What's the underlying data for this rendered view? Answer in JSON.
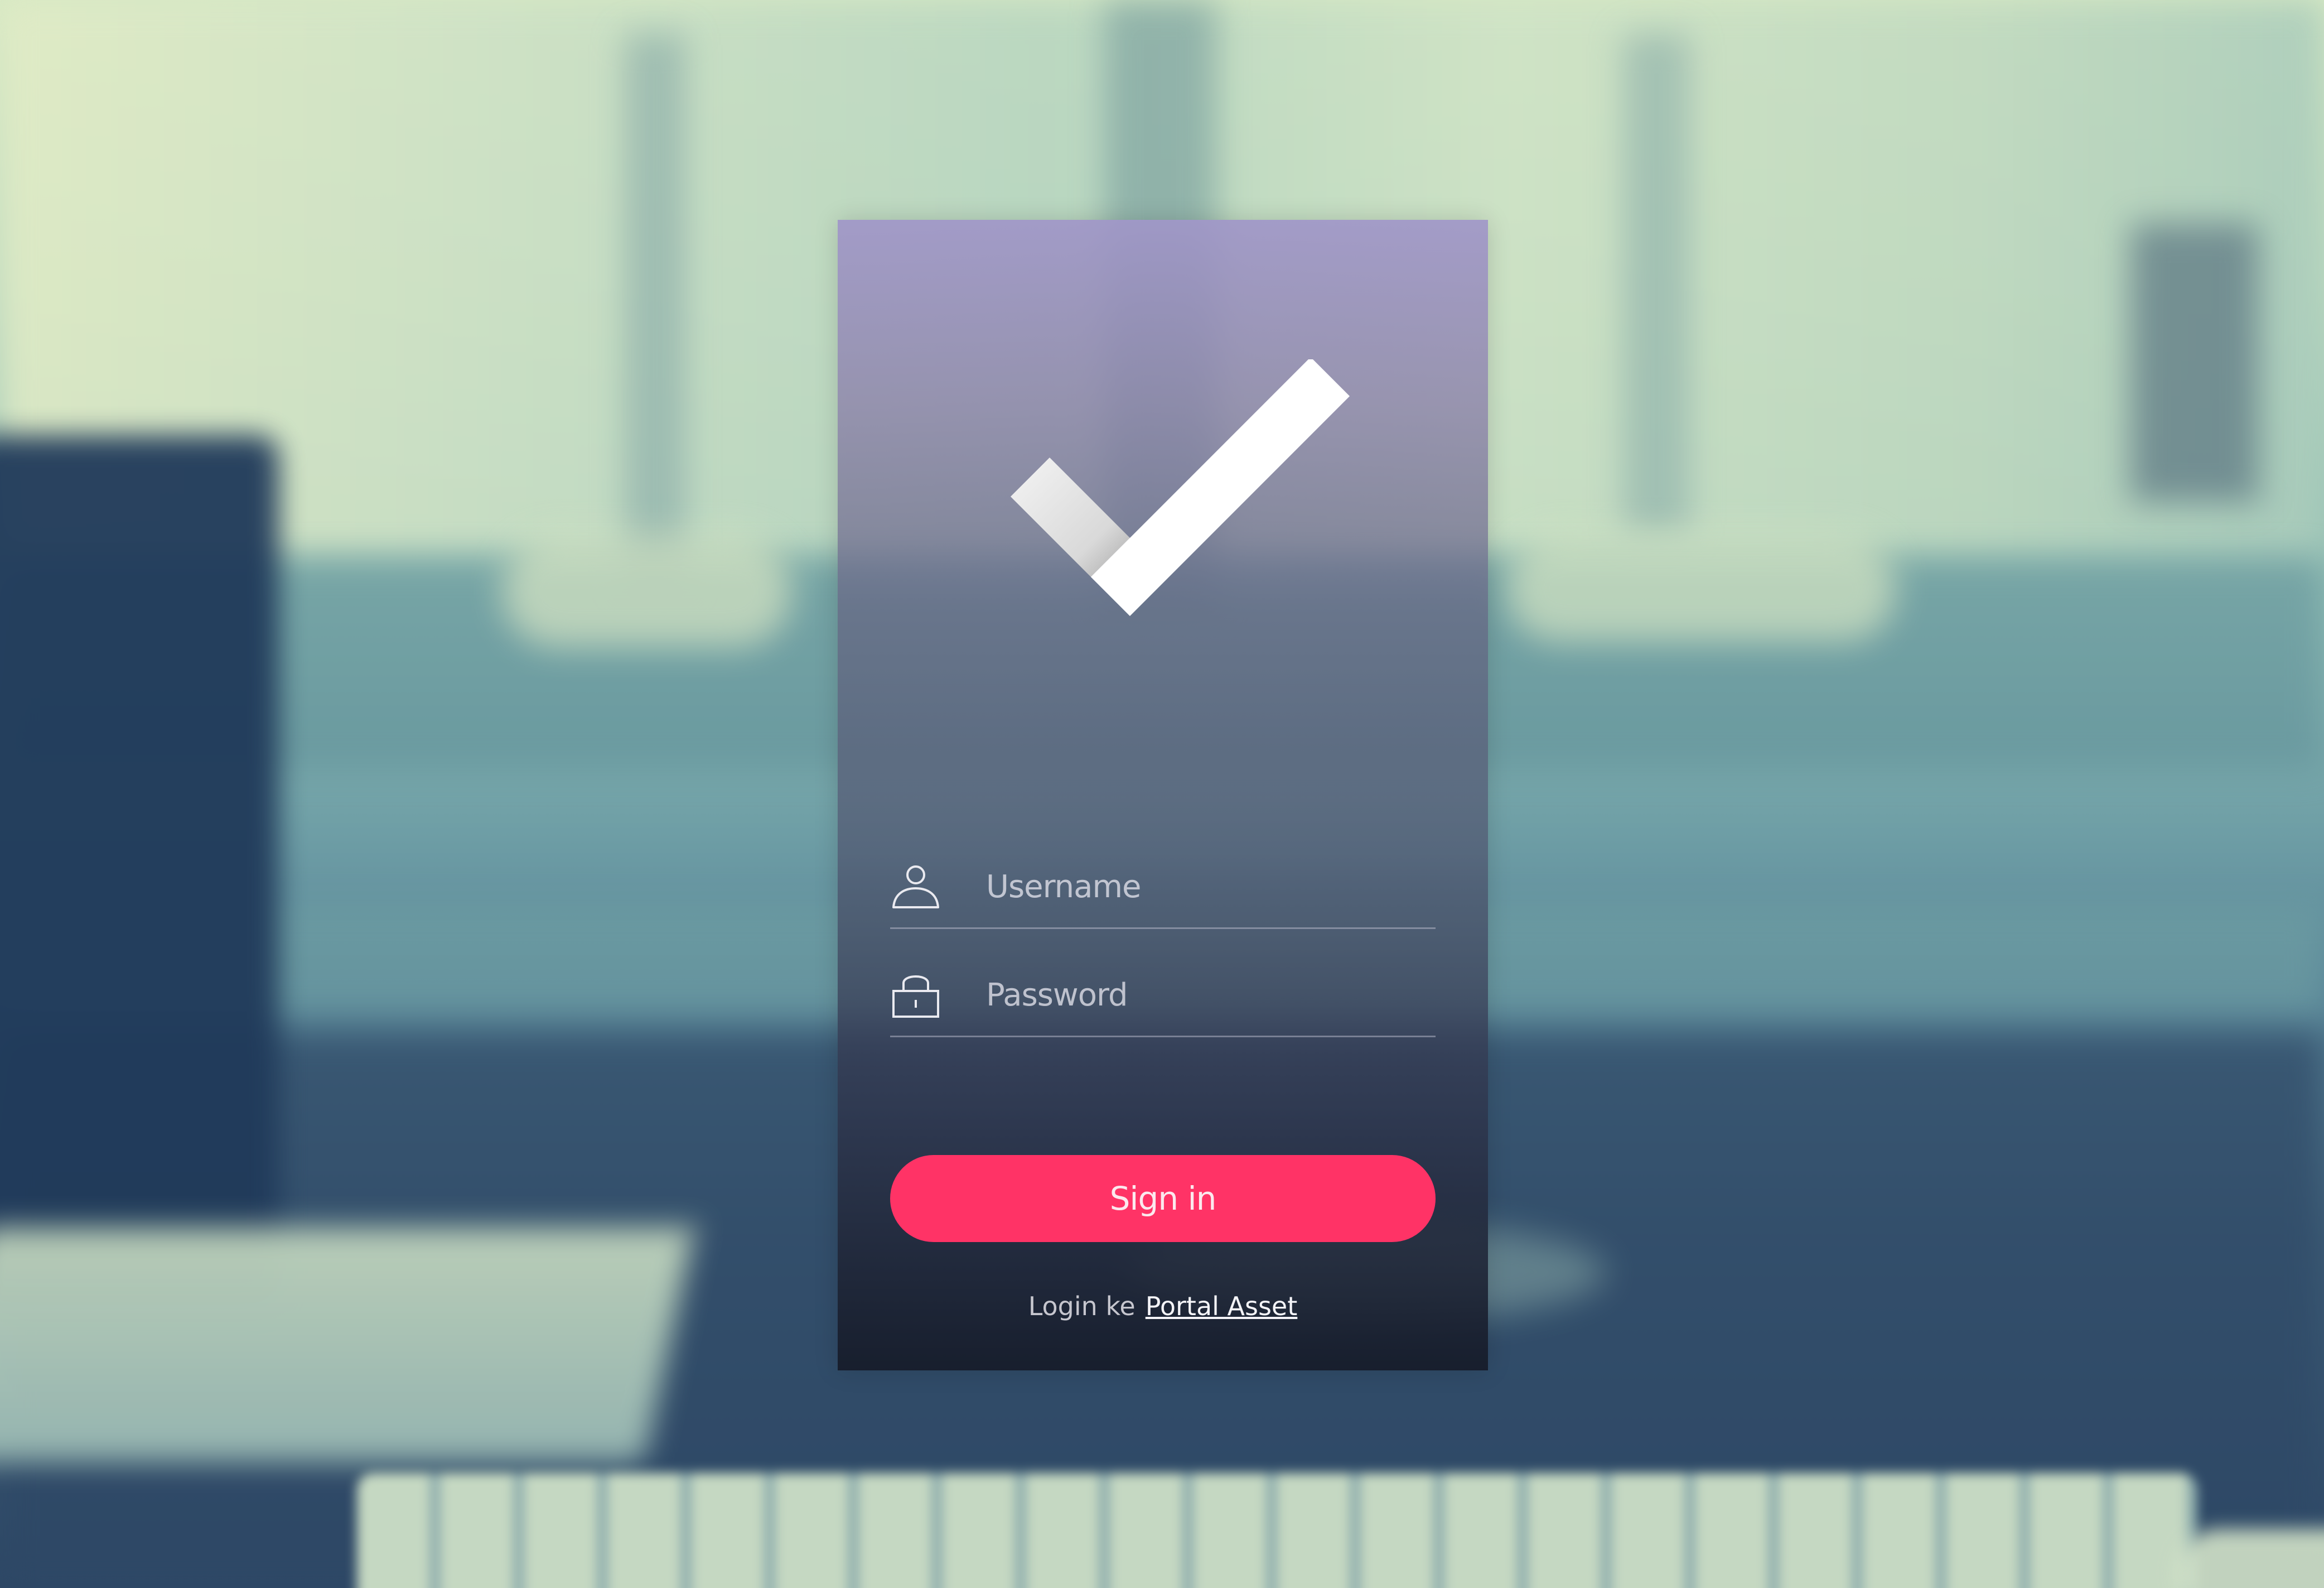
{
  "login_form": {
    "username_placeholder": "Username",
    "password_placeholder": "Password",
    "signin_label": "Sign in",
    "footer_text": "Login ke",
    "footer_link": "Portal Asset"
  },
  "icons": {
    "logo": "checkmark-logo-icon",
    "username": "user-icon",
    "password": "lock-icon"
  },
  "colors": {
    "accent": "#ff3366",
    "card_top": "#a096c8",
    "card_bottom": "#161c2a"
  }
}
